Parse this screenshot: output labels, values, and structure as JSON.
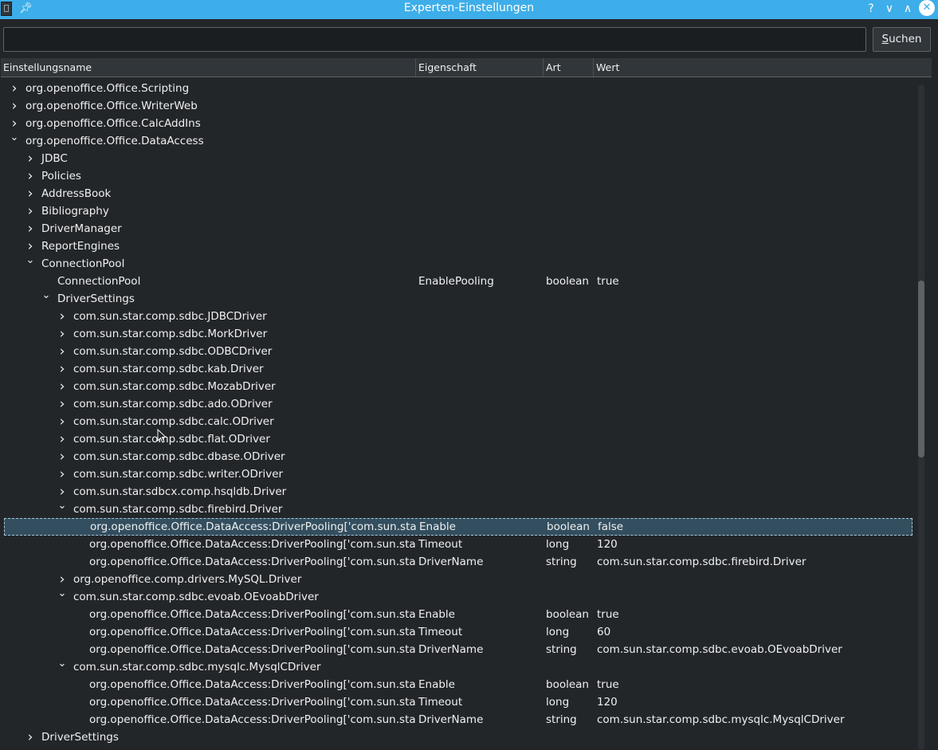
{
  "window": {
    "title": "Experten-Einstellungen",
    "pin_icon": "pin-icon",
    "help_label": "?",
    "minimize_label": "∨",
    "maximize_label": "∧",
    "close_label": "✕"
  },
  "search": {
    "value": "",
    "button_mnemonic": "S",
    "button_rest": "uchen"
  },
  "columns": {
    "name": "Einstellungsname",
    "property": "Eigenschaft",
    "type": "Art",
    "value": "Wert"
  },
  "tree": [
    {
      "level": 0,
      "state": "collapsed",
      "name": "org.openoffice.Office.Scripting"
    },
    {
      "level": 0,
      "state": "collapsed",
      "name": "org.openoffice.Office.WriterWeb"
    },
    {
      "level": 0,
      "state": "collapsed",
      "name": "org.openoffice.Office.CalcAddIns"
    },
    {
      "level": 0,
      "state": "expanded",
      "name": "org.openoffice.Office.DataAccess"
    },
    {
      "level": 1,
      "state": "collapsed",
      "name": "JDBC"
    },
    {
      "level": 1,
      "state": "collapsed",
      "name": "Policies"
    },
    {
      "level": 1,
      "state": "collapsed",
      "name": "AddressBook"
    },
    {
      "level": 1,
      "state": "collapsed",
      "name": "Bibliography"
    },
    {
      "level": 1,
      "state": "collapsed",
      "name": "DriverManager"
    },
    {
      "level": 1,
      "state": "collapsed",
      "name": "ReportEngines"
    },
    {
      "level": 1,
      "state": "expanded",
      "name": "ConnectionPool"
    },
    {
      "level": 2,
      "state": "leaf",
      "name": "ConnectionPool",
      "property": "EnablePooling",
      "type": "boolean",
      "value": "true"
    },
    {
      "level": 2,
      "state": "expanded",
      "name": "DriverSettings"
    },
    {
      "level": 3,
      "state": "collapsed",
      "name": "com.sun.star.comp.sdbc.JDBCDriver"
    },
    {
      "level": 3,
      "state": "collapsed",
      "name": "com.sun.star.comp.sdbc.MorkDriver"
    },
    {
      "level": 3,
      "state": "collapsed",
      "name": "com.sun.star.comp.sdbc.ODBCDriver"
    },
    {
      "level": 3,
      "state": "collapsed",
      "name": "com.sun.star.comp.sdbc.kab.Driver"
    },
    {
      "level": 3,
      "state": "collapsed",
      "name": "com.sun.star.comp.sdbc.MozabDriver"
    },
    {
      "level": 3,
      "state": "collapsed",
      "name": "com.sun.star.comp.sdbc.ado.ODriver"
    },
    {
      "level": 3,
      "state": "collapsed",
      "name": "com.sun.star.comp.sdbc.calc.ODriver"
    },
    {
      "level": 3,
      "state": "collapsed",
      "name": "com.sun.star.comp.sdbc.flat.ODriver"
    },
    {
      "level": 3,
      "state": "collapsed",
      "name": "com.sun.star.comp.sdbc.dbase.ODriver"
    },
    {
      "level": 3,
      "state": "collapsed",
      "name": "com.sun.star.comp.sdbc.writer.ODriver"
    },
    {
      "level": 3,
      "state": "collapsed",
      "name": "com.sun.star.sdbcx.comp.hsqldb.Driver"
    },
    {
      "level": 3,
      "state": "expanded",
      "name": "com.sun.star.comp.sdbc.firebird.Driver"
    },
    {
      "level": 4,
      "state": "leaf",
      "selected": true,
      "name": "org.openoffice.Office.DataAccess:DriverPooling['com.sun.sta",
      "property": "Enable",
      "type": "boolean",
      "value": "false"
    },
    {
      "level": 4,
      "state": "leaf",
      "name": "org.openoffice.Office.DataAccess:DriverPooling['com.sun.sta",
      "property": "Timeout",
      "type": "long",
      "value": "120"
    },
    {
      "level": 4,
      "state": "leaf",
      "name": "org.openoffice.Office.DataAccess:DriverPooling['com.sun.sta",
      "property": "DriverName",
      "type": "string",
      "value": "com.sun.star.comp.sdbc.firebird.Driver"
    },
    {
      "level": 3,
      "state": "collapsed",
      "name": "org.openoffice.comp.drivers.MySQL.Driver"
    },
    {
      "level": 3,
      "state": "expanded",
      "name": "com.sun.star.comp.sdbc.evoab.OEvoabDriver"
    },
    {
      "level": 4,
      "state": "leaf",
      "name": "org.openoffice.Office.DataAccess:DriverPooling['com.sun.sta",
      "property": "Enable",
      "type": "boolean",
      "value": "true"
    },
    {
      "level": 4,
      "state": "leaf",
      "name": "org.openoffice.Office.DataAccess:DriverPooling['com.sun.sta",
      "property": "Timeout",
      "type": "long",
      "value": "60"
    },
    {
      "level": 4,
      "state": "leaf",
      "name": "org.openoffice.Office.DataAccess:DriverPooling['com.sun.sta",
      "property": "DriverName",
      "type": "string",
      "value": "com.sun.star.comp.sdbc.evoab.OEvoabDriver"
    },
    {
      "level": 3,
      "state": "expanded",
      "name": "com.sun.star.comp.sdbc.mysqlc.MysqlCDriver"
    },
    {
      "level": 4,
      "state": "leaf",
      "name": "org.openoffice.Office.DataAccess:DriverPooling['com.sun.sta",
      "property": "Enable",
      "type": "boolean",
      "value": "true"
    },
    {
      "level": 4,
      "state": "leaf",
      "name": "org.openoffice.Office.DataAccess:DriverPooling['com.sun.sta",
      "property": "Timeout",
      "type": "long",
      "value": "120"
    },
    {
      "level": 4,
      "state": "leaf",
      "name": "org.openoffice.Office.DataAccess:DriverPooling['com.sun.sta",
      "property": "DriverName",
      "type": "string",
      "value": "com.sun.star.comp.sdbc.mysqlc.MysqlCDriver"
    },
    {
      "level": 1,
      "state": "collapsed",
      "name": "DriverSettings"
    }
  ],
  "colors": {
    "accent": "#3daee9",
    "background": "#232629",
    "selection": "#334e5e"
  }
}
